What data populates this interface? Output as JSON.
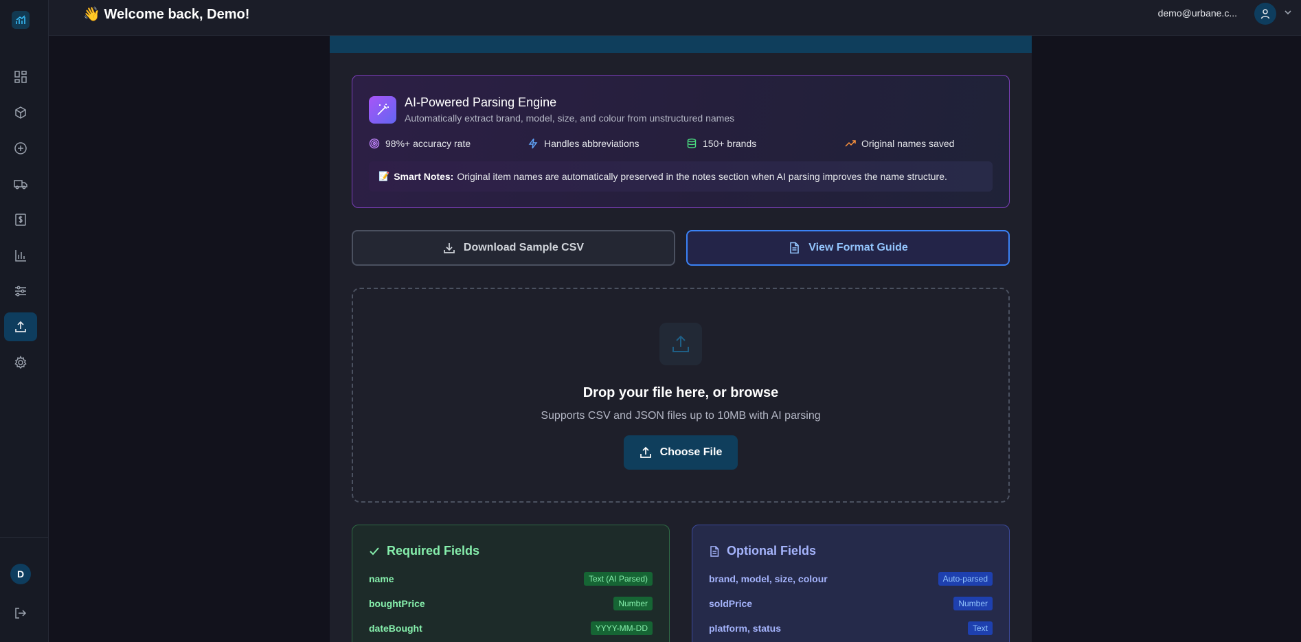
{
  "header": {
    "welcome": "👋 Welcome back, Demo!",
    "user_email": "demo@urbane.c..."
  },
  "sidebar": {
    "items": [
      {
        "icon": "dashboard-icon"
      },
      {
        "icon": "box-icon"
      },
      {
        "icon": "plus-circle-icon"
      },
      {
        "icon": "truck-icon"
      },
      {
        "icon": "dollar-receipt-icon"
      },
      {
        "icon": "bar-chart-icon"
      },
      {
        "icon": "sliders-icon"
      },
      {
        "icon": "upload-icon",
        "active": true
      },
      {
        "icon": "gear-icon"
      }
    ],
    "avatar_initial": "D"
  },
  "ai_card": {
    "title": "AI-Powered Parsing Engine",
    "subtitle": "Automatically extract brand, model, size, and colour from unstructured names",
    "features": [
      {
        "label": "98%+ accuracy rate",
        "icon": "target-icon",
        "color": "#c084fc"
      },
      {
        "label": "Handles abbreviations",
        "icon": "lightning-icon",
        "color": "#60a5fa"
      },
      {
        "label": "150+ brands",
        "icon": "database-icon",
        "color": "#4ade80"
      },
      {
        "label": "Original names saved",
        "icon": "trending-up-icon",
        "color": "#fb923c"
      }
    ],
    "smart_note_label": "Smart Notes:",
    "smart_note_text": "Original item names are automatically preserved in the notes section when AI parsing improves the name structure."
  },
  "actions": {
    "download_label": "Download Sample CSV",
    "guide_label": "View Format Guide"
  },
  "dropzone": {
    "title": "Drop your file here, or browse",
    "subtitle": "Supports CSV and JSON files up to 10MB with AI parsing",
    "button_label": "Choose File"
  },
  "required_fields": {
    "title": "Required Fields",
    "rows": [
      {
        "name": "name",
        "type": "Text (AI Parsed)"
      },
      {
        "name": "boughtPrice",
        "type": "Number"
      },
      {
        "name": "dateBought",
        "type": "YYYY-MM-DD"
      }
    ]
  },
  "optional_fields": {
    "title": "Optional Fields",
    "rows": [
      {
        "name": "brand, model, size, colour",
        "type": "Auto-parsed"
      },
      {
        "name": "soldPrice",
        "type": "Number"
      },
      {
        "name": "platform, status",
        "type": "Text"
      }
    ]
  },
  "colors": {
    "accent": "#0f3e5c",
    "ai_border": "#7b3fb8",
    "required": "#86efac",
    "optional": "#a5b4fc"
  }
}
